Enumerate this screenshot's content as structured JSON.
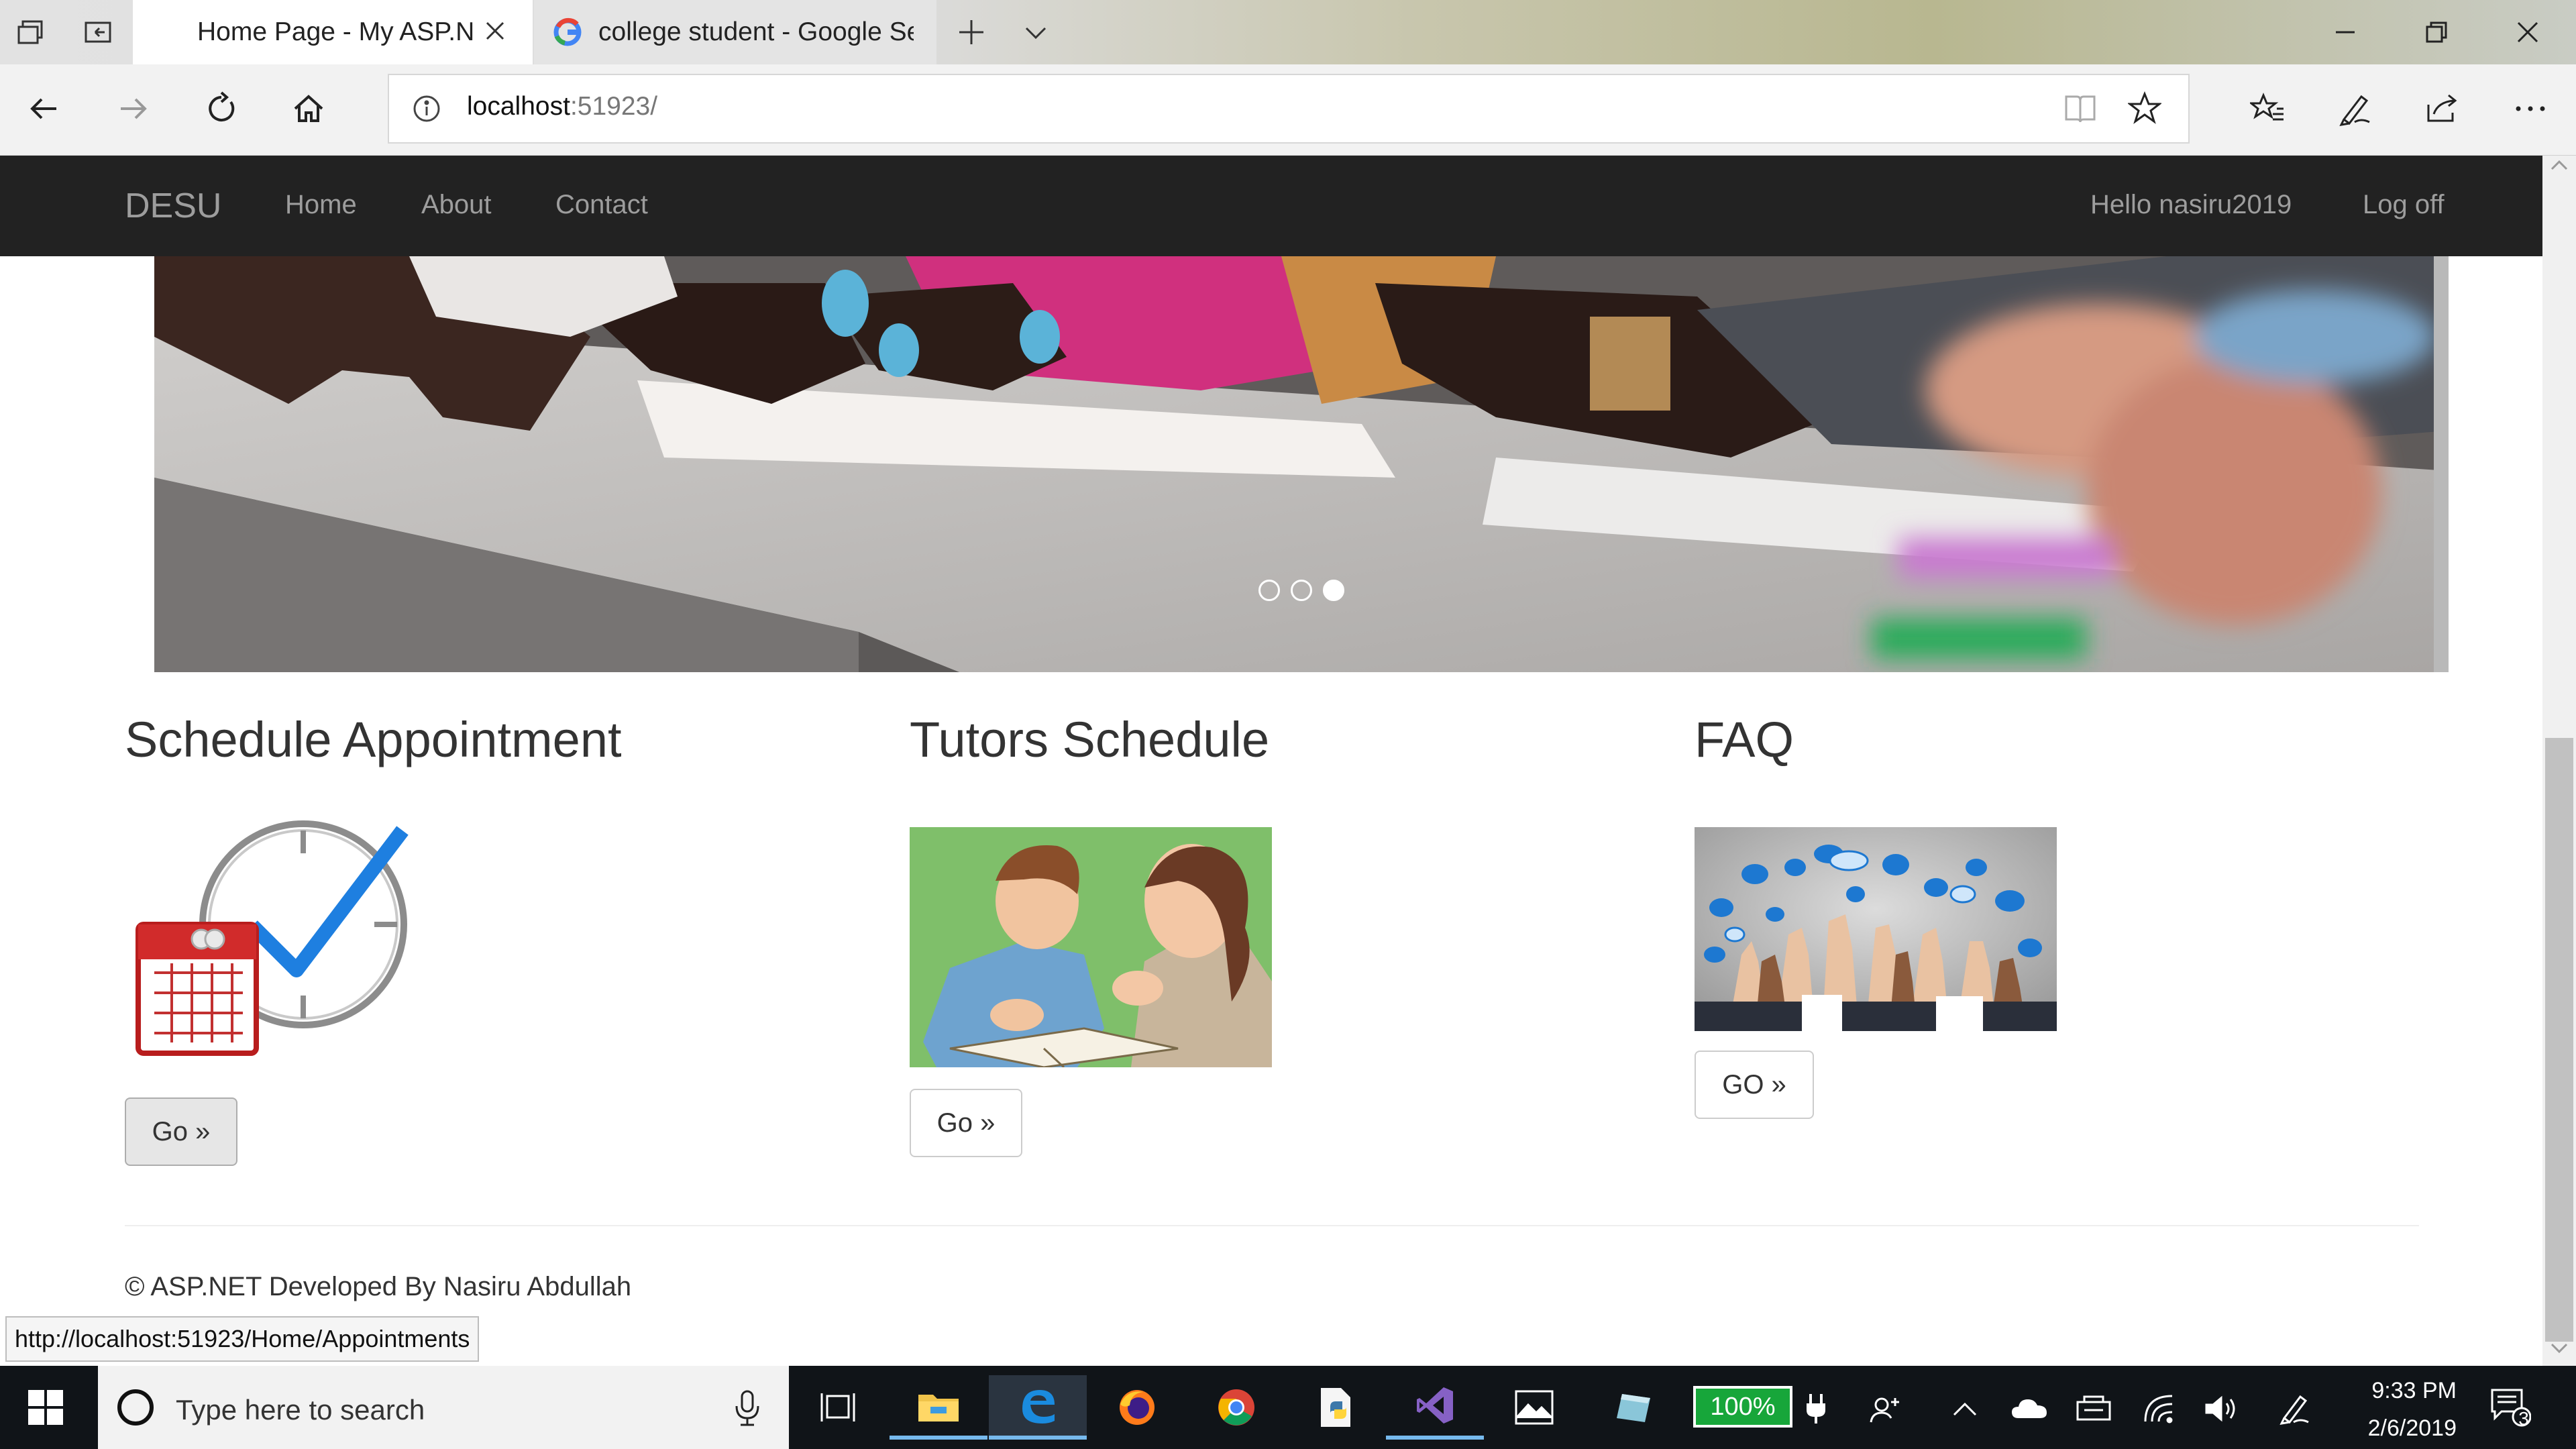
{
  "browser": {
    "tabs": [
      {
        "label": "Home Page - My ASP.N",
        "active": true
      },
      {
        "label": "college student - Google Se",
        "active": false
      }
    ],
    "address": {
      "host": "localhost",
      "port": ":51923/"
    }
  },
  "site": {
    "brand": "DESU",
    "nav": {
      "home": "Home",
      "about": "About",
      "contact": "Contact"
    },
    "user": {
      "greeting": "Hello nasiru2019",
      "logoff": "Log off"
    }
  },
  "carousel": {
    "slides": 3,
    "active_index": 2
  },
  "columns": [
    {
      "title": "Schedule Appointment",
      "button": "Go »"
    },
    {
      "title": "Tutors Schedule",
      "button": "Go »"
    },
    {
      "title": "FAQ",
      "button": "GO »"
    }
  ],
  "footer": {
    "text": "© ASP.NET Developed By Nasiru Abdullah"
  },
  "status_url": "http://localhost:51923/Home/Appointments",
  "taskbar": {
    "search_placeholder": "Type here to search",
    "battery": "100%",
    "time": "9:33 PM",
    "date": "2/6/2019",
    "notifications": "3"
  },
  "colors": {
    "site_nav_bg": "#222222",
    "link": "#9d9d9d",
    "battery": "#17a63a",
    "taskbar": "#101418"
  }
}
